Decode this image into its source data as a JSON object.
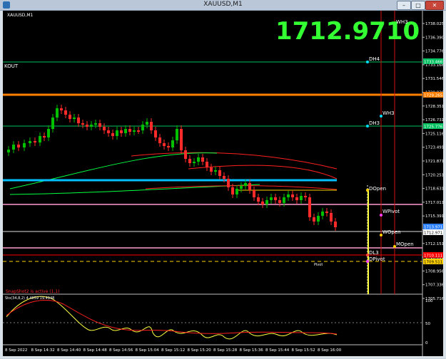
{
  "window": {
    "title": "XAUUSD,M1",
    "buttons": {
      "minimize": "–",
      "maximize": "□",
      "close": "✕"
    }
  },
  "chart": {
    "symbol_label": "XAUUSD,M1",
    "big_price": "1712.9710",
    "left_label": "KOUT",
    "snapshot_label": "SnapShot2 is active (1,1)",
    "indicator_label": "Sto(34,8,2) 4.4859 19.4948",
    "y_ticks": [
      "1738.025",
      "1736.390",
      "1734.776",
      "1733.166",
      "1731.546",
      "1729.926",
      "1728.351",
      "1726.731",
      "1725.116",
      "1723.491",
      "1721.871",
      "1720.251",
      "1718.631",
      "1717.011",
      "1715.391",
      "1713.771",
      "1712.151",
      "1710.531",
      "1708.956",
      "1707.336",
      "1705.716"
    ],
    "price_boxes": {
      "dh4": "1733.466",
      "orange": "1729.265",
      "dh3": "1725.776",
      "current": "1712.971",
      "bid": "1713.971",
      "red1": "1710.111",
      "red2": "1709.511"
    },
    "level_labels": {
      "wh3_top": "WH3",
      "dh4": "DH4",
      "wh3": "WH3",
      "dh3": "DH3",
      "dopen": "DOpen",
      "wpivot": "WPivot",
      "wopen": "WOpen",
      "mopen": "MOpen",
      "dl3": "DL3",
      "dpivot": "DPivot",
      "pivot": "Pivot"
    },
    "osc_ticks": [
      "100",
      "50",
      "0"
    ],
    "x_ticks": [
      "8 Sep 2022",
      "8 Sep 14:32",
      "8 Sep 14:40",
      "8 Sep 14:48",
      "8 Sep 14:56",
      "8 Sep 15:04",
      "8 Sep 15:12",
      "8 Sep 15:20",
      "8 Sep 15:28",
      "8 Sep 15:36",
      "8 Sep 15:44",
      "8 Sep 15:52",
      "8 Sep 16:00"
    ],
    "colors": {
      "bull": "#00c000",
      "bear": "#ff2a2a",
      "big_price": "#33ff33",
      "orange_line": "#ff7f00",
      "cyan_line": "#00bfff",
      "green_line": "#00c060",
      "pink_line": "#ff9bd0",
      "white_line": "#ffffff",
      "red_line": "#ff0000"
    }
  }
}
